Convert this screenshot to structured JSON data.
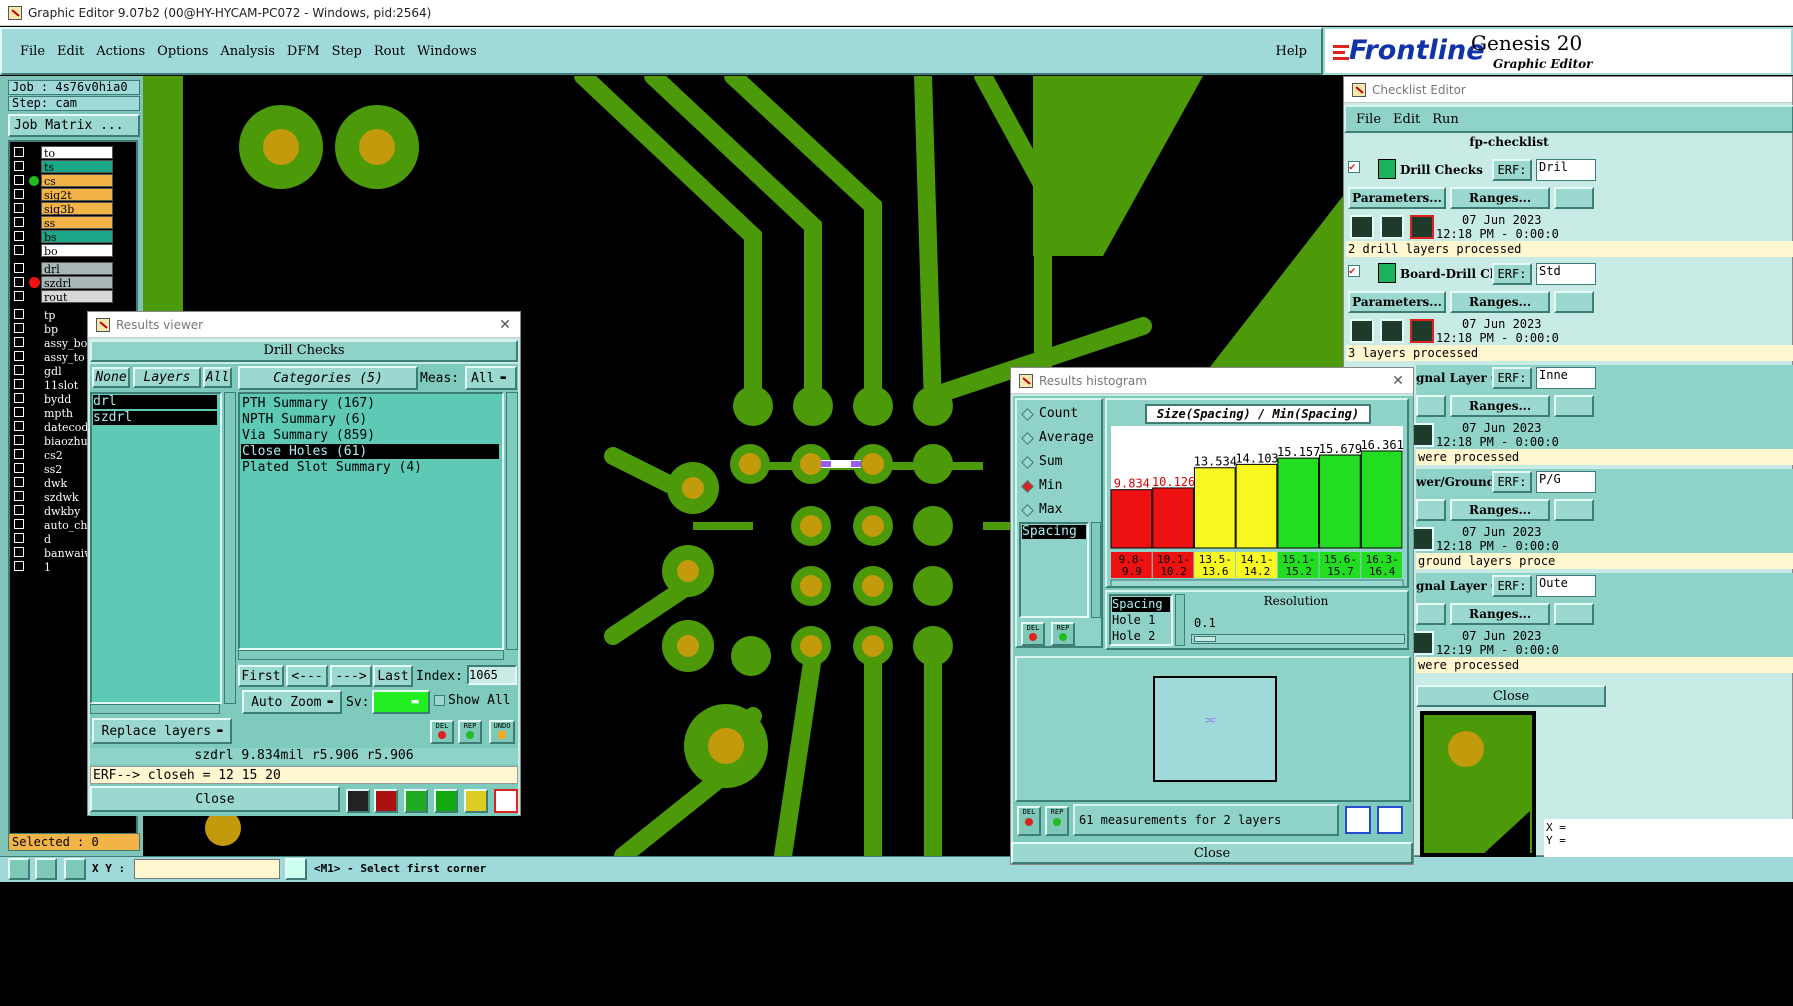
{
  "window": {
    "title": "Graphic Editor 9.07b2 (00@HY-HYCAM-PC072 - Windows, pid:2564)"
  },
  "menubar": {
    "items": [
      "File",
      "Edit",
      "Actions",
      "Options",
      "Analysis",
      "DFM",
      "Step",
      "Rout",
      "Windows"
    ],
    "help": "Help"
  },
  "brand": {
    "logo": "Frontline",
    "product": "Genesis 20",
    "subtitle": "Graphic Editor"
  },
  "job": {
    "job_label": "Job : 4s76v0hia0",
    "step_label": "Step: cam",
    "matrix_button": "Job Matrix ..."
  },
  "layers": {
    "group1": [
      {
        "name": "to",
        "color": "#ffffff"
      },
      {
        "name": "ts",
        "color": "#1aa888"
      },
      {
        "name": "cs",
        "color": "#f2b447"
      },
      {
        "name": "sig2t",
        "color": "#f2b447"
      },
      {
        "name": "sig3b",
        "color": "#f2b447"
      },
      {
        "name": "ss",
        "color": "#f2b447"
      },
      {
        "name": "bs",
        "color": "#1aa888"
      },
      {
        "name": "bo",
        "color": "#ffffff"
      }
    ],
    "group2": [
      {
        "name": "drl",
        "color": "#aab8b8"
      },
      {
        "name": "szdrl",
        "color": "#aab8b8"
      },
      {
        "name": "rout",
        "color": "#d8d8d8"
      }
    ],
    "group3": [
      "tp",
      "bp",
      "assy_bo",
      "assy_to",
      "gdl",
      "11slot",
      "bydd",
      "mpth",
      "datecod",
      "biaozhu",
      "cs2",
      "ss2",
      "dwk",
      "szdwk",
      "dwkby",
      "auto_ch",
      "d",
      "banwaiw",
      "1"
    ]
  },
  "selected_label": "Selected : 0",
  "statusbar": {
    "xy_label": "X Y :",
    "xy_value": "",
    "message": "<M1> - Select first corner"
  },
  "results_viewer": {
    "title": "Results viewer",
    "header": "Drill Checks",
    "layer_buttons": {
      "none": "None",
      "layers": "Layers",
      "all": "All"
    },
    "categories_button": "Categories (5)",
    "meas_label": "Meas:",
    "meas_value": "All",
    "layer_list": [
      "drl",
      "szdrl"
    ],
    "categories": [
      "PTH Summary (167)",
      "NPTH Summary (6)",
      "Via Summary (859)",
      "Close Holes (61)",
      "Plated Slot Summary (4)"
    ],
    "selected_category": 3,
    "nav": {
      "first": "First",
      "prev": "<---",
      "next": "--->",
      "last": "Last",
      "index_label": "Index:",
      "index_value": "1065"
    },
    "auto_zoom": "Auto Zoom",
    "sv_label": "Sv:",
    "show_all": "Show All",
    "replace_layers": "Replace layers",
    "icon_labels": {
      "del": "DEL",
      "rep": "REP",
      "undo": "UNDO"
    },
    "measure_line": "szdrl 9.834mil  r5.906  r5.906",
    "erf_line": "ERF--> closeh = 12 15 20",
    "close": "Close"
  },
  "histogram": {
    "title": "Results histogram",
    "modes": [
      "Count",
      "Average",
      "Sum",
      "Min",
      "Max"
    ],
    "selected_mode": "Min",
    "measure_list": [
      "Spacing"
    ],
    "chart_title": "Size(Spacing) / Min(Spacing)",
    "bar_values": [
      "9.834",
      "10.126",
      "13.534",
      "14.103",
      "15.157",
      "15.679",
      "16.361"
    ],
    "bins": [
      "9.8-\n9.9",
      "10.1-\n10.2",
      "13.5-\n13.6",
      "14.1-\n14.2",
      "15.1-\n15.2",
      "15.6-\n15.7",
      "16.3-\n16.4"
    ],
    "bin_colors": [
      "#ee1111",
      "#ee1111",
      "#f7f722",
      "#f7f722",
      "#22dd22",
      "#22dd22",
      "#22dd22"
    ],
    "attr_list": [
      "Spacing",
      "Hole 1",
      "Hole 2"
    ],
    "resolution_label": "Resolution",
    "resolution_value": "0.1",
    "summary": "61 measurements for 2 layers",
    "icon_labels": {
      "del": "DEL",
      "rep": "REP"
    },
    "close": "Close"
  },
  "chart_data": {
    "type": "bar",
    "title": "Size(Spacing) / Min(Spacing)",
    "categories": [
      "9.8-9.9",
      "10.1-10.2",
      "13.5-13.6",
      "14.1-14.2",
      "15.1-15.2",
      "15.6-15.7",
      "16.3-16.4"
    ],
    "values": [
      9.834,
      10.126,
      13.534,
      14.103,
      15.157,
      15.679,
      16.361
    ],
    "xlabel": "",
    "ylabel": ""
  },
  "checklist": {
    "title": "Checklist Editor",
    "menu": [
      "File",
      "Edit",
      "Run"
    ],
    "name": "fp-checklist",
    "erf_label": "ERF:",
    "params_label": "Parameters...",
    "ranges_label": "Ranges...",
    "close": "Close",
    "items": [
      {
        "name": "Drill Checks",
        "erf": "Dril",
        "date": "07 Jun 2023",
        "time": "12:18 PM - 0:00:0",
        "status": "2 drill layers processed"
      },
      {
        "name": "Board-Drill Che",
        "erf": "Std",
        "date": "07 Jun 2023",
        "time": "12:18 PM - 0:00:0",
        "status": "3 layers processed"
      },
      {
        "name": "gnal Layer Ch",
        "erf": "Inne",
        "date": "07 Jun 2023",
        "time": "12:18 PM - 0:00:0",
        "status": "were processed"
      },
      {
        "name": "wer/Ground C",
        "erf": "P/G",
        "date": "07 Jun 2023",
        "time": "12:18 PM - 0:00:0",
        "status": "ground layers proce"
      },
      {
        "name": "gnal Layer Ch",
        "erf": "Oute",
        "date": "07 Jun 2023",
        "time": "12:19 PM - 0:00:0",
        "status": "were processed"
      }
    ]
  },
  "coords": {
    "x": "X =",
    "y": "Y ="
  },
  "colors": {
    "board": "#4c9a0a",
    "copper": "#4c9a0a",
    "pad": "#c39a0c",
    "void": "#000000",
    "panel": "#8fd2c8"
  }
}
